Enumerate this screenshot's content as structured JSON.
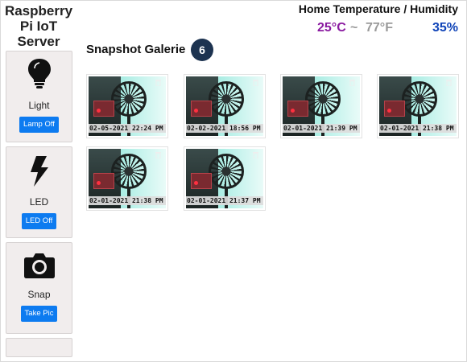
{
  "brand": {
    "line1": "Raspberry",
    "line2": "Pi IoT",
    "line3": "Server"
  },
  "sidebar": {
    "light": {
      "label": "Light",
      "button": "Lamp Off",
      "icon": "lightbulb-icon"
    },
    "led": {
      "label": "LED",
      "button": "LED Off",
      "icon": "lightning-icon"
    },
    "snap": {
      "label": "Snap",
      "button": "Take Pic",
      "icon": "camera-icon"
    }
  },
  "environment": {
    "title": "Home Temperature / Humidity",
    "temp_c": "25°C",
    "separator": "~",
    "temp_f": "77°F",
    "humidity": "35%"
  },
  "gallery": {
    "title": "Snapshot Galerie",
    "count": "6",
    "snapshots": [
      {
        "timestamp": "02-05-2021 22:24 PM"
      },
      {
        "timestamp": "02-02-2021 18:56 PM"
      },
      {
        "timestamp": "02-01-2021 21:39 PM"
      },
      {
        "timestamp": "02-01-2021 21:38 PM"
      },
      {
        "timestamp": "02-01-2021 21:38 PM"
      },
      {
        "timestamp": "02-01-2021 21:37 PM"
      }
    ]
  },
  "colors": {
    "primary_button": "#0d7bf0",
    "temp_c": "#8a1aa0",
    "temp_f": "#9a9a9a",
    "humidity": "#1044b8",
    "badge": "#1d3350"
  }
}
